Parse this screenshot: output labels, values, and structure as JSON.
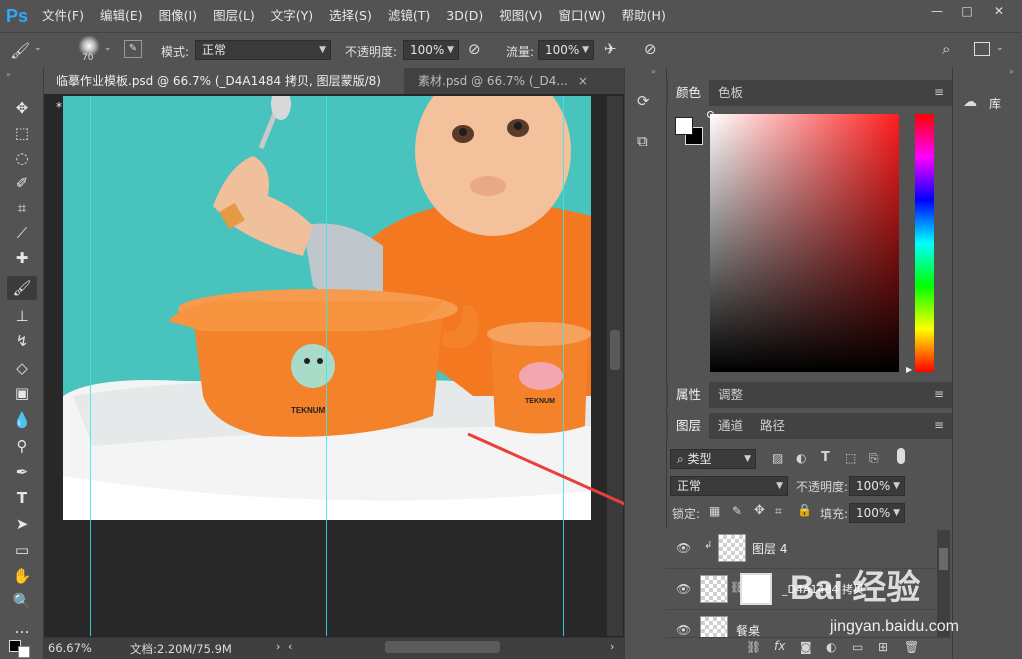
{
  "app": {
    "logo": "Ps"
  },
  "menu": [
    "文件(F)",
    "编辑(E)",
    "图像(I)",
    "图层(L)",
    "文字(Y)",
    "选择(S)",
    "滤镜(T)",
    "3D(D)",
    "视图(V)",
    "窗口(W)",
    "帮助(H)"
  ],
  "window_controls": {
    "minimize": "—",
    "maximize": "□",
    "close": "✕"
  },
  "options": {
    "brush_size": "70",
    "mode_label": "模式:",
    "mode_value": "正常",
    "opacity_label": "不透明度:",
    "opacity_value": "100%",
    "flow_label": "流量:",
    "flow_value": "100%"
  },
  "tabs": [
    {
      "label": "临摹作业模板.psd @ 66.7% (_D4A1484 拷贝, 图层蒙版/8) *",
      "close": "×"
    },
    {
      "label": "素材.psd @ 66.7% (_D4...",
      "close": "×"
    }
  ],
  "canvas": {
    "bowl_brand": "TEKNUM",
    "cup_brand": "TEKNUM"
  },
  "status": {
    "zoom": "66.67%",
    "doc": "文档:2.20M/75.9M"
  },
  "panels": {
    "color_tabs": [
      "颜色",
      "色板"
    ],
    "props_tabs": [
      "属性",
      "调整"
    ],
    "layer_tabs": [
      "图层",
      "通道",
      "路径"
    ],
    "library": "库",
    "filter_kind": "类型",
    "blend_mode": "正常",
    "opacity_label": "不透明度:",
    "opacity_value": "100%",
    "lock_label": "锁定:",
    "fill_label": "填充:",
    "fill_value": "100%",
    "menu_icon": "≡",
    "fx": "fx"
  },
  "layers": [
    {
      "name": "图层 4"
    },
    {
      "name": "_D4A1484 拷贝"
    },
    {
      "name": "餐桌"
    }
  ],
  "watermark": {
    "text": "Bai 经验",
    "url": "jingyan.baidu.com"
  },
  "colors": {
    "accent": "#31a8ff",
    "canvas_bg": "#48c3bd",
    "orange": "#f4822a",
    "arrow": "#e8403a",
    "guide": "#3ee6e6"
  }
}
